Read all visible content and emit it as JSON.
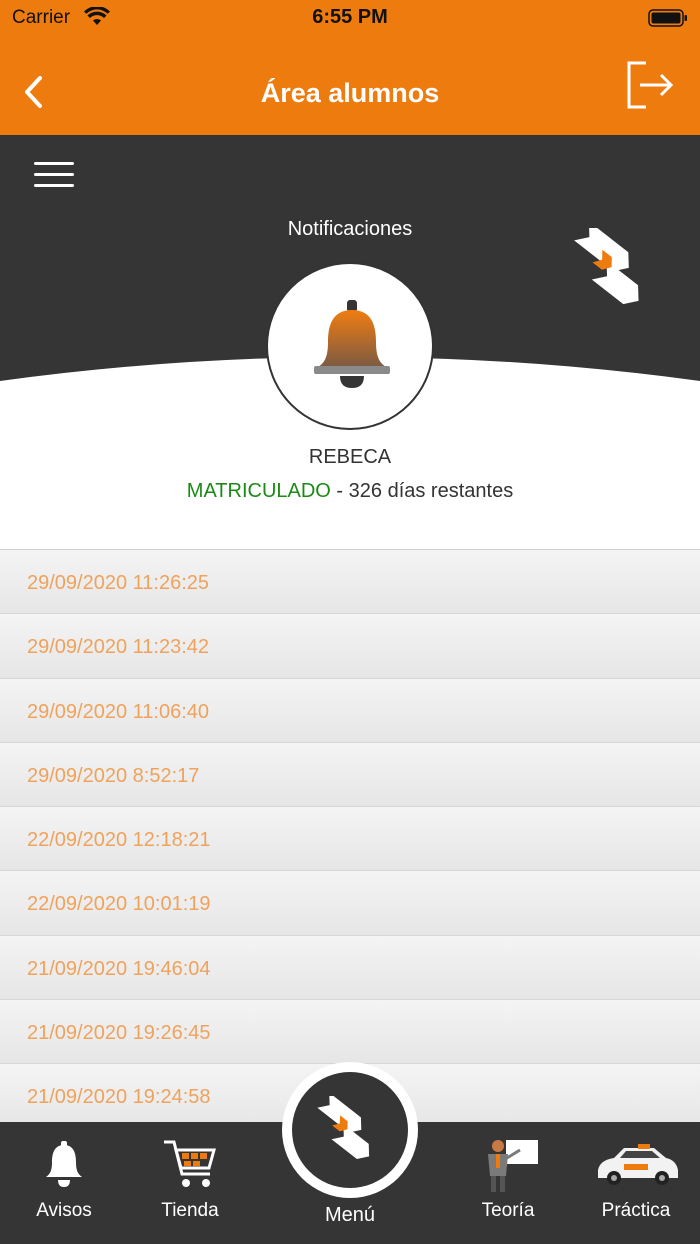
{
  "status_bar": {
    "carrier": "Carrier",
    "time": "6:55 PM"
  },
  "nav": {
    "title": "Área alumnos",
    "back_icon": "chevron-left-icon",
    "logout_icon": "logout-icon"
  },
  "header": {
    "section_title": "Notificaciones"
  },
  "user": {
    "name": "REBECA",
    "status": "MATRICULADO",
    "remaining": " - 326 días restantes"
  },
  "notifications": [
    "29/09/2020 11:26:25",
    "29/09/2020 11:23:42",
    "29/09/2020 11:06:40",
    "29/09/2020 8:52:17",
    "22/09/2020 12:18:21",
    "22/09/2020 10:01:19",
    "21/09/2020 19:46:04",
    "21/09/2020 19:26:45",
    "21/09/2020 19:24:58"
  ],
  "tabs": {
    "avisos": "Avisos",
    "tienda": "Tienda",
    "menu": "Menú",
    "teoria": "Teoría",
    "practica": "Práctica"
  },
  "colors": {
    "accent": "#ee7b0e",
    "dark": "#353535",
    "enrolled": "#1b8a16",
    "notification_text": "#f0a25c"
  }
}
